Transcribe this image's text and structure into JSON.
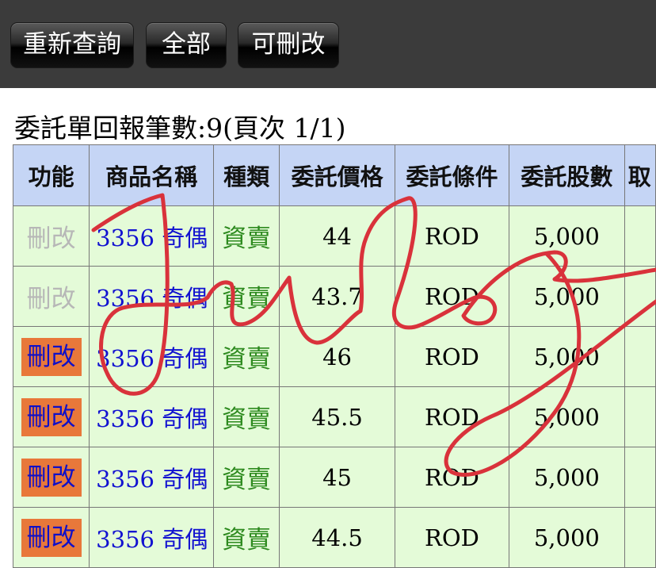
{
  "toolbar": {
    "buttons": [
      {
        "label": "重新查詢"
      },
      {
        "label": "全部"
      },
      {
        "label": "可刪改"
      }
    ]
  },
  "summary": {
    "text": "委託單回報筆數:9(頁次 1/1)"
  },
  "table": {
    "headers": [
      "功能",
      "商品名稱",
      "種類",
      "委託價格",
      "委託條件",
      "委託股數",
      "取"
    ],
    "rows": [
      {
        "action": "刪改",
        "action_enabled": false,
        "stock": "3356 奇偶",
        "side": "資賣",
        "price": "44",
        "condition": "ROD",
        "qty": "5,000"
      },
      {
        "action": "刪改",
        "action_enabled": false,
        "stock": "3356 奇偶",
        "side": "資賣",
        "price": "43.7",
        "condition": "ROD",
        "qty": "5,000"
      },
      {
        "action": "刪改",
        "action_enabled": true,
        "stock": "3356 奇偶",
        "side": "資賣",
        "price": "46",
        "condition": "ROD",
        "qty": "5,000"
      },
      {
        "action": "刪改",
        "action_enabled": true,
        "stock": "3356 奇偶",
        "side": "資賣",
        "price": "45.5",
        "condition": "ROD",
        "qty": "5,000"
      },
      {
        "action": "刪改",
        "action_enabled": true,
        "stock": "3356 奇偶",
        "side": "資賣",
        "price": "45",
        "condition": "ROD",
        "qty": "5,000"
      },
      {
        "action": "刪改",
        "action_enabled": true,
        "stock": "3356 奇偶",
        "side": "資賣",
        "price": "44.5",
        "condition": "ROD",
        "qty": "5,000"
      }
    ]
  },
  "overlay": {
    "handwriting": "July",
    "ink_color": "#d9323b"
  }
}
